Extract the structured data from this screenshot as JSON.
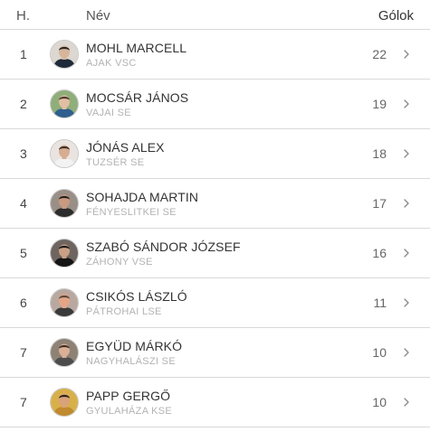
{
  "header": {
    "rank_label": "H.",
    "name_label": "Név",
    "goals_label": "Gólok"
  },
  "rows": [
    {
      "rank": "1",
      "name": "MOHL MARCELL",
      "club": "AJAK VSC",
      "goals": "22",
      "avatar": {
        "skin": "#d7b59b",
        "hair": "#2a2420",
        "shirt": "#1f2a3a",
        "bg": "#dcd7d0"
      }
    },
    {
      "rank": "2",
      "name": "MOCSÁR JÁNOS",
      "club": "VAJAI SE",
      "goals": "19",
      "avatar": {
        "skin": "#e2bfa3",
        "hair": "#4a3a2c",
        "shirt": "#2f5f8f",
        "bg": "#8fae7a"
      }
    },
    {
      "rank": "3",
      "name": "JÓNÁS ALEX",
      "club": "TUZSÉR SE",
      "goals": "18",
      "avatar": {
        "skin": "#d6ad92",
        "hair": "#3a2e26",
        "shirt": "#f2f2f2",
        "bg": "#e9e4df"
      }
    },
    {
      "rank": "4",
      "name": "SOHAJDA MARTIN",
      "club": "FÉNYESLITKEI SE",
      "goals": "17",
      "avatar": {
        "skin": "#c99a80",
        "hair": "#241c18",
        "shirt": "#2c2c2c",
        "bg": "#9a8f86"
      }
    },
    {
      "rank": "5",
      "name": "SZABÓ SÁNDOR JÓZSEF",
      "club": "ZÁHONY VSE",
      "goals": "16",
      "avatar": {
        "skin": "#caa084",
        "hair": "#1c1816",
        "shirt": "#151515",
        "bg": "#6f6560"
      }
    },
    {
      "rank": "6",
      "name": "CSIKÓS LÁSZLÓ",
      "club": "PÁTROHAI LSE",
      "goals": "11",
      "avatar": {
        "skin": "#e4a586",
        "hair": "#5a4636",
        "shirt": "#3a3a3a",
        "bg": "#b9a8a0"
      }
    },
    {
      "rank": "7",
      "name": "EGYÜD MÁRKÓ",
      "club": "NAGYHALÁSZI SE",
      "goals": "10",
      "avatar": {
        "skin": "#d9b096",
        "hair": "#3b2d24",
        "shirt": "#4d4d4d",
        "bg": "#8e8275"
      }
    },
    {
      "rank": "7",
      "name": "PAPP GERGŐ",
      "club": "GYULAHÁZA KSE",
      "goals": "10",
      "avatar": {
        "skin": "#d9a27c",
        "hair": "#2b2118",
        "shirt": "#c08a2e",
        "bg": "#d8b04a"
      }
    }
  ],
  "icons": {
    "row_arrow": "chevron-right-icon",
    "avatar": "player-avatar"
  }
}
